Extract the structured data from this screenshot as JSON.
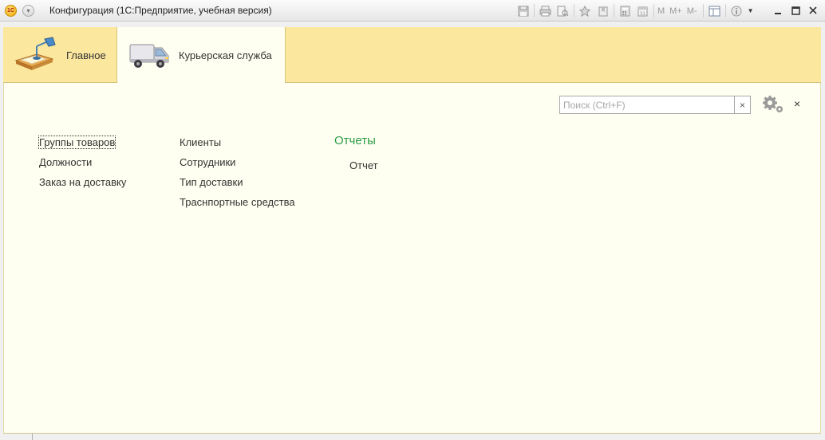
{
  "window": {
    "title": "Конфигурация  (1С:Предприятие, учебная версия)",
    "logo_text": "1С"
  },
  "toolbar": {
    "icons": [
      "save-icon",
      "print-icon",
      "print-preview-icon",
      "favorites-icon",
      "bookmark-icon",
      "calculator-icon",
      "calendar-icon"
    ],
    "memory_labels": [
      "M",
      "M+",
      "M-"
    ],
    "after_icons": [
      "panel-layout-icon",
      "info-icon",
      "dropdown-arrow-icon"
    ]
  },
  "window_controls": {
    "minimize": "–",
    "maximize": "□",
    "close": "✕"
  },
  "sections": [
    {
      "label": "Главное",
      "icon": "desk-lamp-icon",
      "active": false
    },
    {
      "label": "Курьерская служба",
      "icon": "delivery-van-icon",
      "active": true
    }
  ],
  "search": {
    "placeholder": "Поиск (Ctrl+F)",
    "value": "",
    "clear": "×"
  },
  "panel_close": "×",
  "columns": {
    "col1": [
      "Группы товаров",
      "Должности",
      "Заказ на доставку"
    ],
    "col2": [
      "Клиенты",
      "Сотрудники",
      "Тип доставки",
      "Траснпортные средства"
    ]
  },
  "reports": {
    "header": "Отчеты",
    "items": [
      "Отчет"
    ]
  },
  "colors": {
    "sections_bar": "#fbe79e",
    "content_bg": "#fffff1",
    "reports_header": "#2b9c46"
  }
}
